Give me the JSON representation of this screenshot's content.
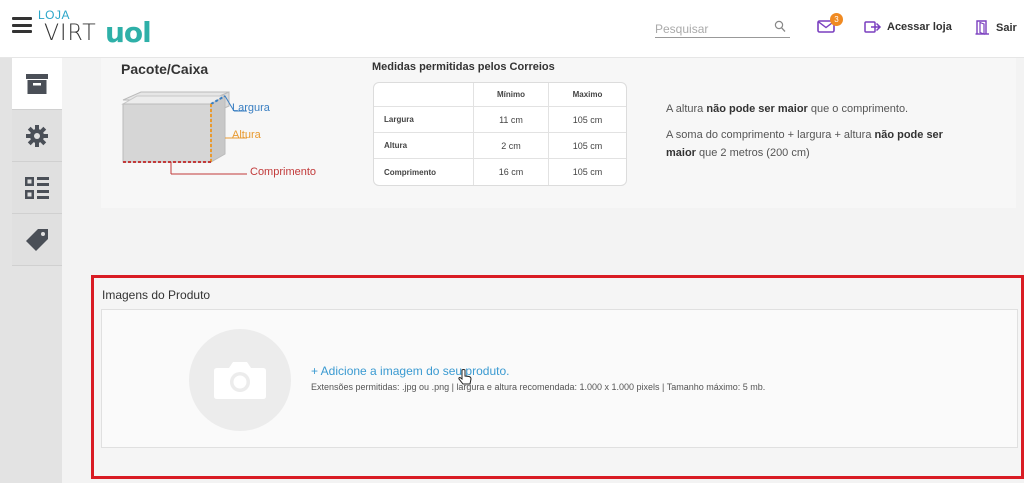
{
  "header": {
    "logo_loja": "LOJA",
    "logo_virt": "VIRT",
    "logo_uol": "uol",
    "search_placeholder": "Pesquisar",
    "mail_count": "3",
    "acessar_label": "Acessar loja",
    "sair_label": "Sair"
  },
  "sidebar": {
    "items": [
      {
        "icon": "archive-icon",
        "active": true
      },
      {
        "icon": "gear-icon",
        "active": false
      },
      {
        "icon": "dashboard-icon",
        "active": false
      },
      {
        "icon": "tag-icon",
        "active": false
      }
    ]
  },
  "package": {
    "title": "Pacote/Caixa",
    "labels": {
      "largura": "Largura",
      "altura": "Altura",
      "comprimento": "Comprimento"
    }
  },
  "measures": {
    "title": "Medidas permitidas pelos Correios",
    "headers": [
      "",
      "Mínimo",
      "Maximo"
    ],
    "rows": [
      {
        "label": "Largura",
        "min": "11 cm",
        "max": "105 cm"
      },
      {
        "label": "Altura",
        "min": "2 cm",
        "max": "105 cm"
      },
      {
        "label": "Comprimento",
        "min": "16 cm",
        "max": "105 cm"
      }
    ]
  },
  "rules": {
    "r1_pre": "A altura ",
    "r1_bold": "não pode ser maior",
    "r1_post": " que o comprimento.",
    "r2_pre": "A soma do comprimento + largura + altura ",
    "r2_bold": "não pode ser maior",
    "r2_post": " que 2 metros (200 cm)"
  },
  "images": {
    "title": "Imagens do Produto",
    "add_link": "+ Adicione a imagem do seu produto.",
    "hint": "Extensões permitidas: .jpg ou .png | largura e altura recomendada: 1.000 x 1.000 pixels | Tamanho máximo: 5 mb."
  },
  "colors": {
    "highlight_border": "#d91c24",
    "link": "#3a9ad1",
    "brand_teal": "#2eb0a8",
    "badge": "#f08a22",
    "accent_purple": "#7a3fbf"
  }
}
